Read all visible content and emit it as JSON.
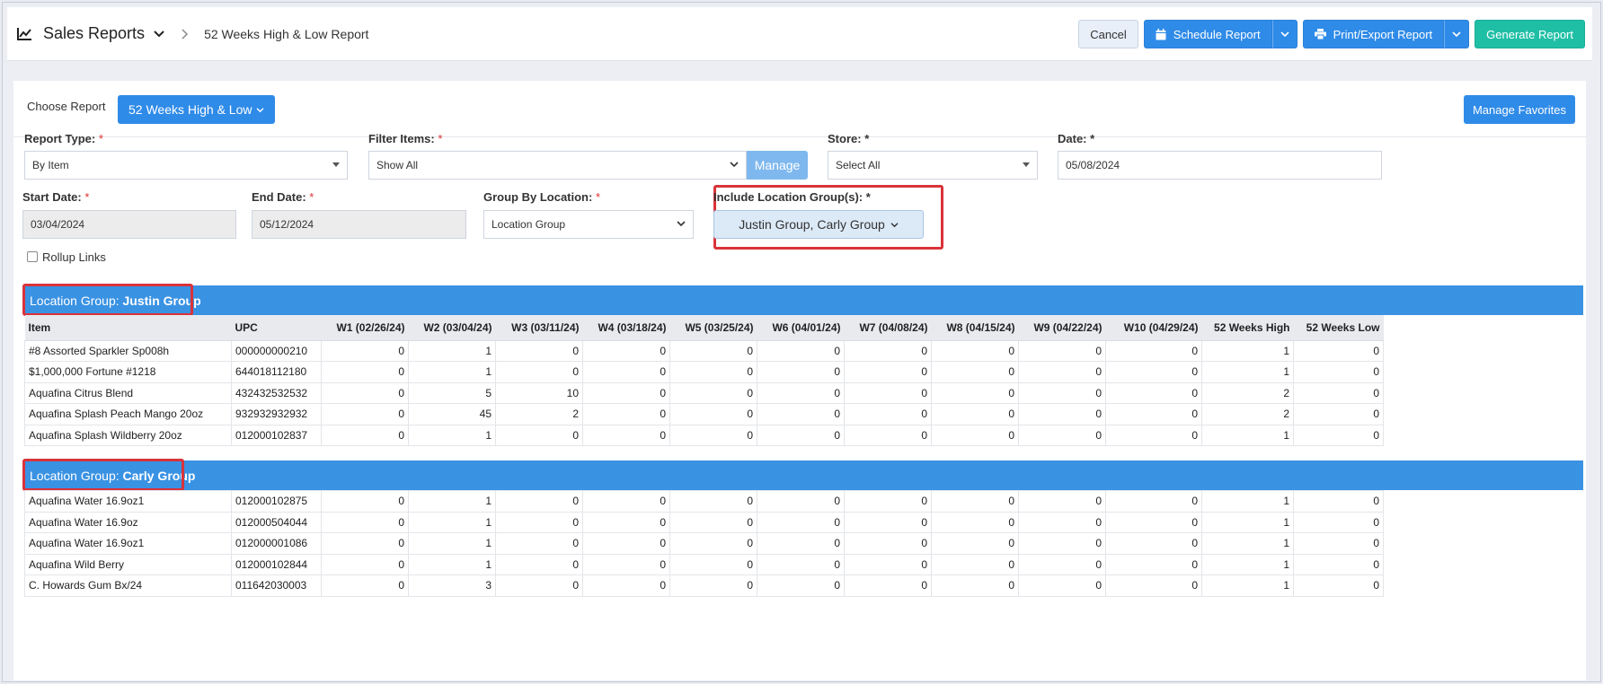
{
  "header": {
    "title": "Sales Reports",
    "breadcrumb": "52 Weeks High & Low Report",
    "cancel": "Cancel",
    "schedule": "Schedule Report",
    "print_export": "Print/Export Report",
    "generate": "Generate Report"
  },
  "choose": {
    "label": "Choose Report",
    "selected": "52 Weeks High & Low",
    "manage_favorites": "Manage Favorites"
  },
  "form": {
    "report_type_label": "Report Type:",
    "report_type": "By Item",
    "filter_items_label": "Filter Items:",
    "filter_items": "Show All",
    "manage": "Manage",
    "store_label": "Store:",
    "store": "Select All",
    "date_label": "Date:",
    "date": "05/08/2024",
    "start_date_label": "Start Date:",
    "start_date": "03/04/2024",
    "end_date_label": "End Date:",
    "end_date": "05/12/2024",
    "group_by_label": "Group By Location:",
    "group_by": "Location Group",
    "include_groups_label": "Include Location Group(s):",
    "include_groups": "Justin Group, Carly Group",
    "rollup_label": "Rollup Links",
    "req": "*"
  },
  "table": {
    "columns": [
      "Item",
      "UPC",
      "W1 (02/26/24)",
      "W2 (03/04/24)",
      "W3 (03/11/24)",
      "W4 (03/18/24)",
      "W5 (03/25/24)",
      "W6 (04/01/24)",
      "W7 (04/08/24)",
      "W8 (04/15/24)",
      "W9 (04/22/24)",
      "W10 (04/29/24)",
      "52 Weeks High",
      "52 Weeks Low"
    ]
  },
  "groups": [
    {
      "prefix": "Location Group: ",
      "name": "Justin Group",
      "rows": [
        [
          "#8 Assorted Sparkler Sp008h",
          "000000000210",
          "0",
          "1",
          "0",
          "0",
          "0",
          "0",
          "0",
          "0",
          "0",
          "0",
          "1",
          "0"
        ],
        [
          "$1,000,000 Fortune #1218",
          "644018112180",
          "0",
          "1",
          "0",
          "0",
          "0",
          "0",
          "0",
          "0",
          "0",
          "0",
          "1",
          "0"
        ],
        [
          "Aquafina Citrus Blend",
          "432432532532",
          "0",
          "5",
          "10",
          "0",
          "0",
          "0",
          "0",
          "0",
          "0",
          "0",
          "2",
          "0"
        ],
        [
          "Aquafina Splash Peach Mango 20oz",
          "932932932932",
          "0",
          "45",
          "2",
          "0",
          "0",
          "0",
          "0",
          "0",
          "0",
          "0",
          "2",
          "0"
        ],
        [
          "Aquafina Splash Wildberry 20oz",
          "012000102837",
          "0",
          "1",
          "0",
          "0",
          "0",
          "0",
          "0",
          "0",
          "0",
          "0",
          "1",
          "0"
        ]
      ]
    },
    {
      "prefix": "Location Group: ",
      "name": "Carly Group",
      "rows": [
        [
          "Aquafina Water 16.9oz1",
          "012000102875",
          "0",
          "1",
          "0",
          "0",
          "0",
          "0",
          "0",
          "0",
          "0",
          "0",
          "1",
          "0"
        ],
        [
          "Aquafina Water 16.9oz",
          "012000504044",
          "0",
          "1",
          "0",
          "0",
          "0",
          "0",
          "0",
          "0",
          "0",
          "0",
          "1",
          "0"
        ],
        [
          "Aquafina Water 16.9oz1",
          "012000001086",
          "0",
          "1",
          "0",
          "0",
          "0",
          "0",
          "0",
          "0",
          "0",
          "0",
          "1",
          "0"
        ],
        [
          "Aquafina Wild Berry",
          "012000102844",
          "0",
          "1",
          "0",
          "0",
          "0",
          "0",
          "0",
          "0",
          "0",
          "0",
          "1",
          "0"
        ],
        [
          "C. Howards Gum Bx/24",
          "011642030003",
          "0",
          "3",
          "0",
          "0",
          "0",
          "0",
          "0",
          "0",
          "0",
          "0",
          "1",
          "0"
        ]
      ]
    }
  ],
  "colors": {
    "primary": "#2f8be8",
    "teal": "#1fbfa6",
    "group_header": "#3a92e3",
    "highlight": "#d9333a"
  }
}
